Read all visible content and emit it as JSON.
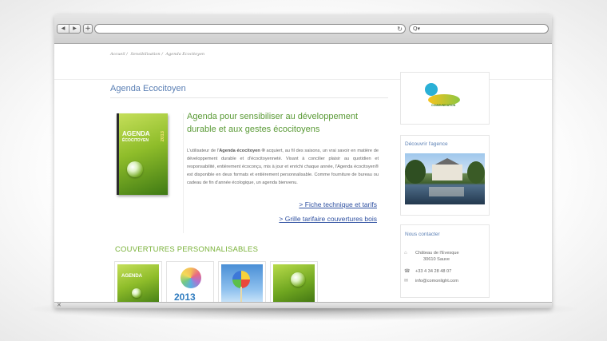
{
  "browser": {
    "back_icon": "◀",
    "forward_icon": "▶",
    "new_tab_icon": "+",
    "reload_icon": "↻",
    "search_icon": "Q▾",
    "status_close_icon": "✕"
  },
  "breadcrumb": {
    "items": [
      "Accueil /",
      "Sensibilisation /",
      "Agenda Ecocitoyen"
    ]
  },
  "page": {
    "title": "Agenda Ecocitoyen",
    "headline": "Agenda pour sensibiliser au développement durable et aux gestes écocitoyens",
    "body_prefix": "L'utilisateur de l'",
    "body_bold": "Agenda écocitoyen ®",
    "body_rest": " acquiert, au fil des saisons, un vrai savoir en matière de développement durable et d'écocitoyenneté. Visant à concilier plaisir au quotidien et responsabilité, entièrement écoconçu, mis à jour et enrichi chaque année, l'Agenda écocitoyen® est disponible en deux formats et entièrement personnalisable. Comme fourniture de bureau ou cadeau de fin d'année écologique, un agenda bienvenu.",
    "link_fiche": "> Fiche technique et tarifs",
    "link_grille": "> Grille tarifaire couvertures bois"
  },
  "cover": {
    "title_line1": "AGENDA",
    "title_line2": "ÉCOCITOYEN",
    "year": "2013"
  },
  "covers_section": {
    "title": "COUVERTURES PERSONNALISABLES",
    "thumb1_title": "AGENDA",
    "thumb2_year": "2013"
  },
  "sidebar": {
    "logo_text": "COMMUNICATION",
    "agency_title": "Découvrir l'agence",
    "contact_title": "Nous contacter",
    "address_line1": "Château de l'Evesque",
    "address_line2": "30610 Sauve",
    "phone": "+33 4 34 28 48 07",
    "email": "info@comonlight.com",
    "home_icon": "⌂",
    "phone_icon": "☎",
    "mail_icon": "✉"
  }
}
